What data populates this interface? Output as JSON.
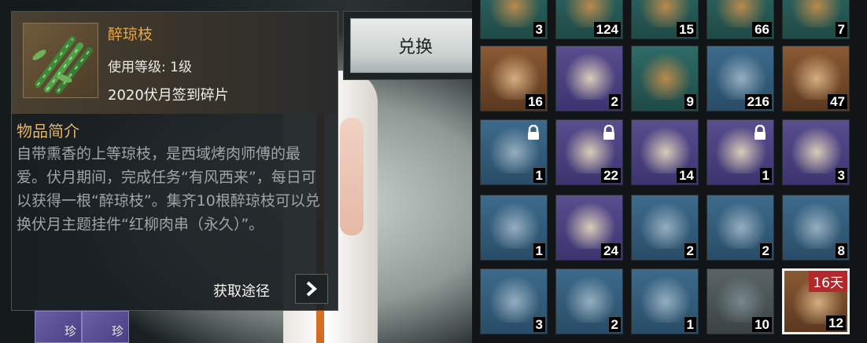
{
  "tooltip": {
    "item_name": "醉琼枝",
    "level_req": "使用等级: 1级",
    "source": "2020伏月签到碎片",
    "desc_title": "物品简介",
    "description": "自带熏香的上等琼枝，是西域烤肉师傅的最爱。伏月期间，完成任务“有风西来”，每日可以获得一根“醉琼枝”。集齐10根醉琼枝可以兑换伏月主题挂件“红柳肉串（永久）”。",
    "acquire_label": "获取途径"
  },
  "exchange": {
    "label": "兑换"
  },
  "small_slots": [
    {
      "badge": "珍"
    },
    {
      "badge": "珍"
    }
  ],
  "inventory": {
    "rows": [
      [
        {
          "count": "3",
          "color": "teal"
        },
        {
          "count": "124",
          "color": "teal"
        },
        {
          "count": "15",
          "color": "teal"
        },
        {
          "count": "66",
          "color": "teal"
        },
        {
          "count": "7",
          "color": "teal"
        }
      ],
      [
        {
          "count": "16",
          "color": "brown"
        },
        {
          "count": "2",
          "color": "purple"
        },
        {
          "count": "9",
          "color": "teal"
        },
        {
          "count": "216",
          "color": "blue"
        },
        {
          "count": "47",
          "color": "brown"
        }
      ],
      [
        {
          "count": "1",
          "color": "blue",
          "locked": true
        },
        {
          "count": "22",
          "color": "purple",
          "locked": true
        },
        {
          "count": "14",
          "color": "purple"
        },
        {
          "count": "1",
          "color": "purple",
          "locked": true
        },
        {
          "count": "3",
          "color": "purple"
        }
      ],
      [
        {
          "count": "1",
          "color": "blue"
        },
        {
          "count": "24",
          "color": "purple"
        },
        {
          "count": "2",
          "color": "blue"
        },
        {
          "count": "2",
          "color": "blue"
        },
        {
          "count": "8",
          "color": "blue"
        }
      ],
      [
        {
          "count": "3",
          "color": "blue"
        },
        {
          "count": "2",
          "color": "blue"
        },
        {
          "count": "1",
          "color": "blue"
        },
        {
          "count": "10",
          "color": "gray"
        },
        {
          "count": "12",
          "color": "brown",
          "expiry": "16天",
          "selected": true
        }
      ]
    ]
  }
}
